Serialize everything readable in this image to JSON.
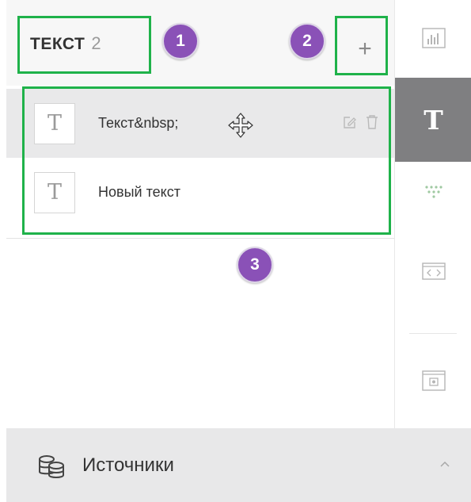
{
  "panel": {
    "title": "ТЕКСТ",
    "count": "2",
    "add_label": "+"
  },
  "items": [
    {
      "icon_letter": "T",
      "label": "Текст&nbsp;",
      "selected": true
    },
    {
      "icon_letter": "T",
      "label": "Новый текст",
      "selected": false
    }
  ],
  "toolbar": {
    "text_letter": "T",
    "active_color": "#7f7f81"
  },
  "sources": {
    "label": "Источники"
  },
  "annotations": {
    "badges": [
      "1",
      "2",
      "3"
    ],
    "highlight_color": "#1fb24a",
    "badge_color": "#8a51b7"
  }
}
